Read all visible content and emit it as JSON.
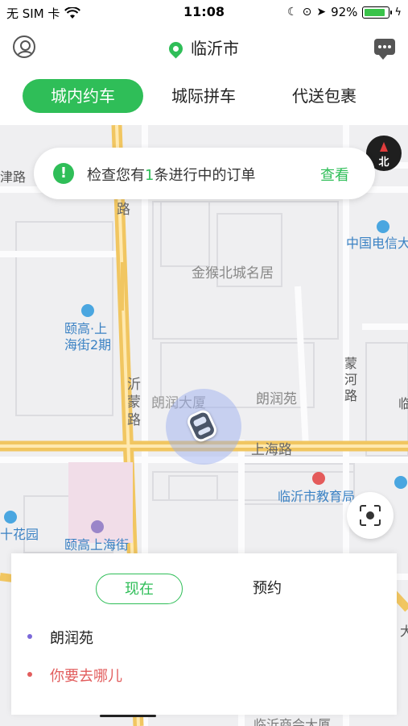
{
  "status_bar": {
    "carrier": "无 SIM 卡",
    "time": "11:08",
    "battery_percent": "92%",
    "battery_level": 0.92
  },
  "header": {
    "city": "临沂市",
    "profile_icon": "person-circle-icon",
    "message_icon": "chat-bubble-icon"
  },
  "tabs": [
    {
      "label": "城内约车",
      "active": true
    },
    {
      "label": "城际拼车",
      "active": false
    },
    {
      "label": "代送包裹",
      "active": false
    }
  ],
  "notice": {
    "prefix": "检查您有",
    "count": "1",
    "suffix": "条进行中的订单",
    "action": "查看"
  },
  "compass": {
    "label": "北"
  },
  "map_labels": {
    "road_left": "津路",
    "road_vertical": "路",
    "telecom": "中国电信大",
    "jinhou": "金猴北城名居",
    "yigao1": "颐高·上",
    "yigao2": "海街2期",
    "meng1": "蒙",
    "meng2": "河",
    "meng3": "路",
    "yi1": "沂",
    "yi2": "蒙",
    "yi3": "路",
    "langrun_building": "朗润大厦",
    "langrun_garden": "朗润苑",
    "right_edge": "临",
    "shanghai_road": "上海路",
    "education": "临沂市教育局",
    "flower": "十花园",
    "yigao_street": "颐高上海街",
    "right_bottom": "大",
    "bottom": "临沂商会大厦"
  },
  "panel": {
    "mode_now": "现在",
    "mode_reserve": "预约",
    "origin": "朗润苑",
    "destination_placeholder": "你要去哪儿"
  },
  "colors": {
    "accent": "#2fbe58",
    "origin_dot": "#7b68d9",
    "destination": "#e25d5d"
  }
}
